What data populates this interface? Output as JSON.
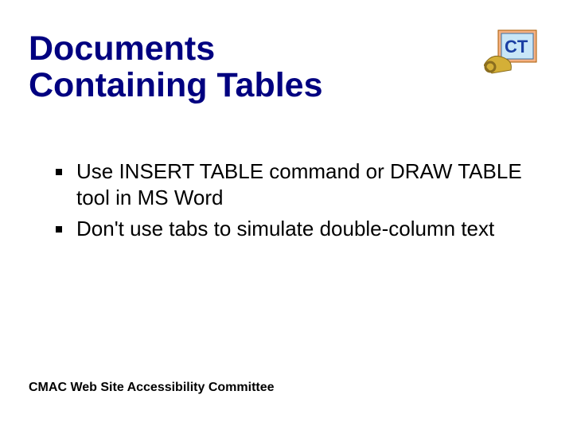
{
  "title_line1": "Documents",
  "title_line2": "Containing Tables",
  "bullets": [
    "Use INSERT TABLE command or DRAW TABLE tool in MS Word",
    "Don't use tabs to simulate double-column text"
  ],
  "footer": "CMAC Web Site Accessibility Committee",
  "logo": {
    "label": "CT"
  }
}
